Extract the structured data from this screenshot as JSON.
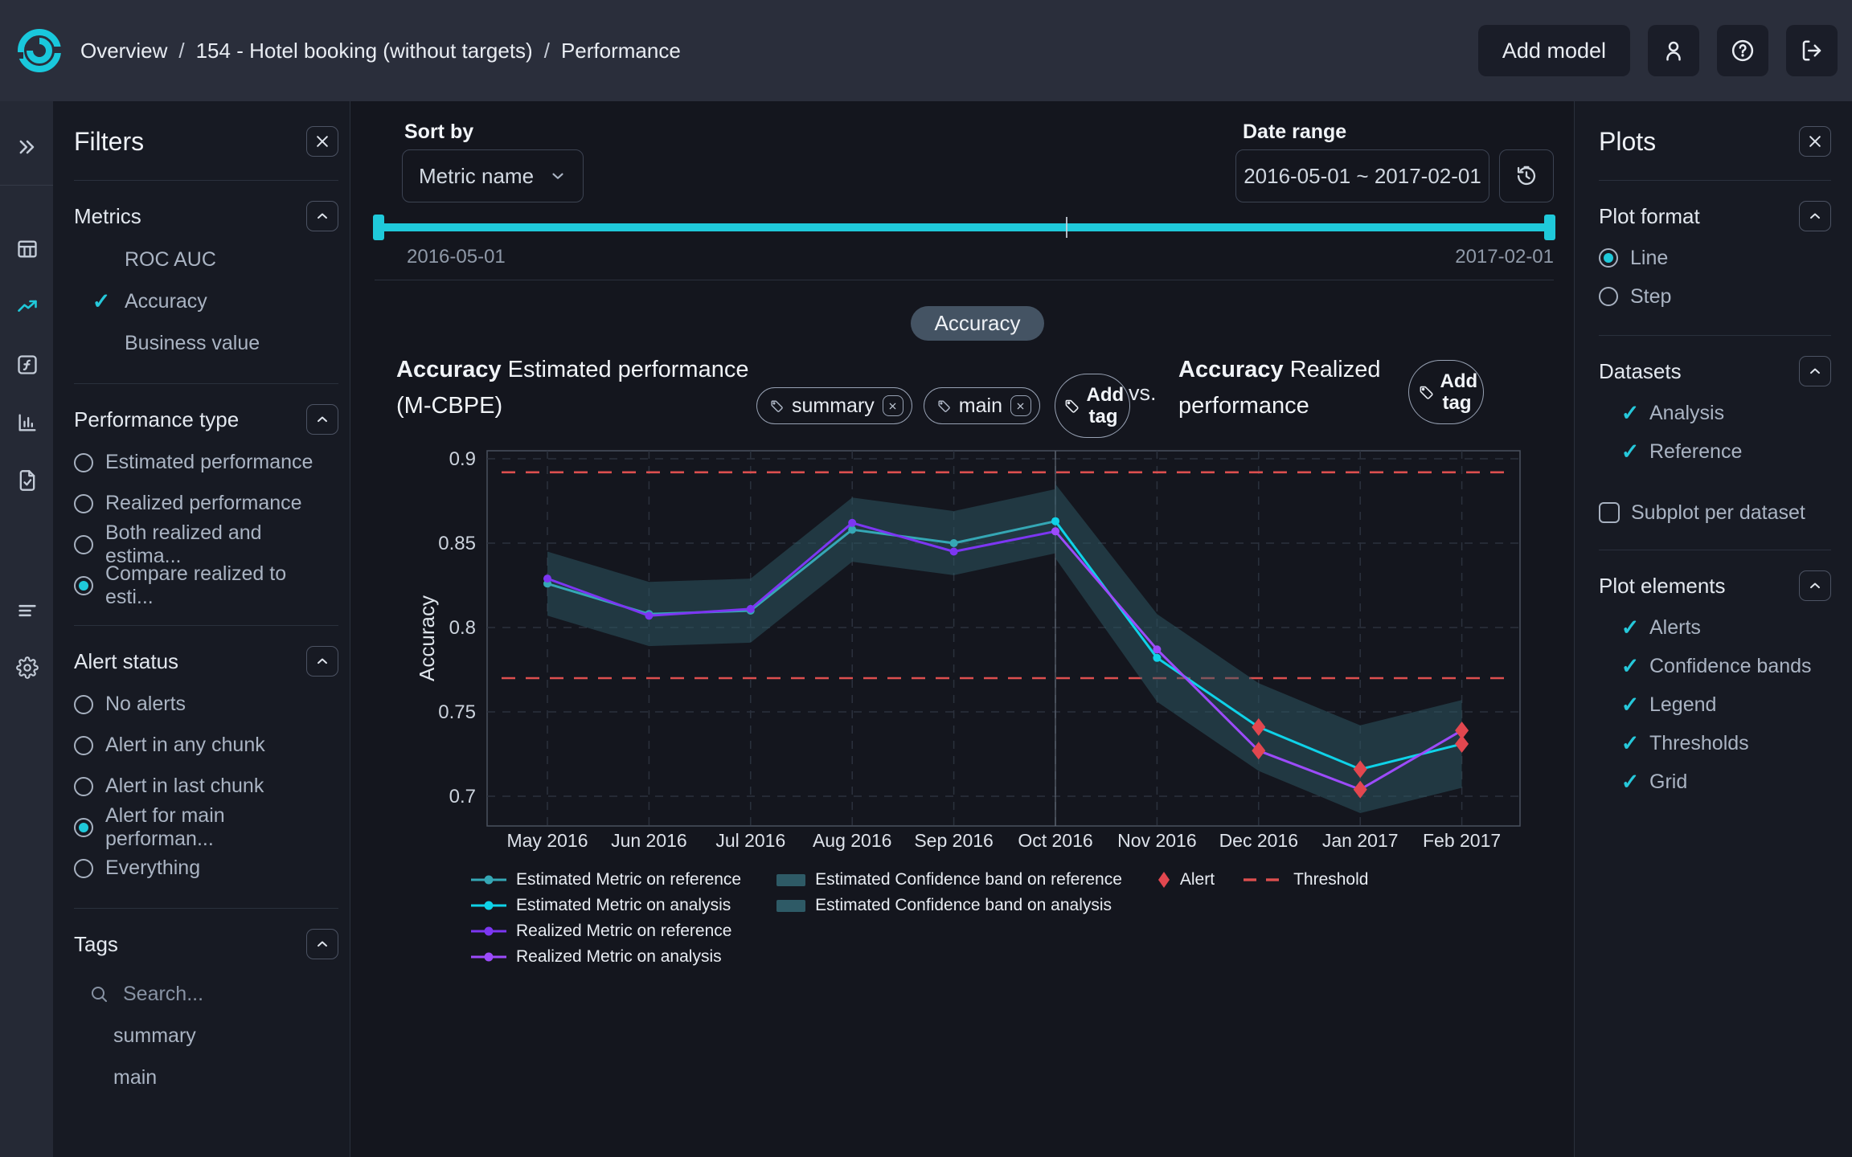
{
  "header": {
    "breadcrumb": [
      "Overview",
      "154 - Hotel booking (without targets)",
      "Performance"
    ],
    "separator": "/",
    "add_model_label": "Add model"
  },
  "toolbar": {
    "sort_by_label": "Sort by",
    "sort_by_value": "Metric name",
    "date_range_label": "Date range",
    "date_range_value": "2016-05-01 ~ 2017-02-01",
    "slider_start": "2016-05-01",
    "slider_end": "2017-02-01"
  },
  "filters": {
    "title": "Filters",
    "metrics": {
      "title": "Metrics",
      "items": [
        {
          "label": "ROC AUC",
          "checked": false
        },
        {
          "label": "Accuracy",
          "checked": true
        },
        {
          "label": "Business value",
          "checked": false
        }
      ]
    },
    "performance_type": {
      "title": "Performance type",
      "options": [
        {
          "label": "Estimated performance",
          "selected": false
        },
        {
          "label": "Realized performance",
          "selected": false
        },
        {
          "label": "Both realized and estima...",
          "selected": false
        },
        {
          "label": "Compare realized to esti...",
          "selected": true
        }
      ]
    },
    "alert_status": {
      "title": "Alert status",
      "options": [
        {
          "label": "No alerts",
          "selected": false
        },
        {
          "label": "Alert in any chunk",
          "selected": false
        },
        {
          "label": "Alert in last chunk",
          "selected": false
        },
        {
          "label": "Alert for main performan...",
          "selected": true
        },
        {
          "label": "Everything",
          "selected": false
        }
      ]
    },
    "tags": {
      "title": "Tags",
      "search_placeholder": "Search...",
      "items": [
        "summary",
        "main"
      ]
    }
  },
  "plot_header": {
    "metric_pill": "Accuracy",
    "left_title_bold": "Accuracy",
    "left_title_rest": " Estimated performance (M-CBPE)",
    "tags": [
      "summary",
      "main"
    ],
    "add_tag_label": "Add tag",
    "vs_label": "vs.",
    "right_title_bold": "Accuracy",
    "right_title_rest": " Realized performance"
  },
  "plots_panel": {
    "title": "Plots",
    "plot_format": {
      "title": "Plot format",
      "options": [
        {
          "label": "Line",
          "selected": true
        },
        {
          "label": "Step",
          "selected": false
        }
      ]
    },
    "datasets": {
      "title": "Datasets",
      "items": [
        {
          "label": "Analysis",
          "checked": true
        },
        {
          "label": "Reference",
          "checked": true
        }
      ],
      "subplot_label": "Subplot per dataset",
      "subplot_checked": false
    },
    "plot_elements": {
      "title": "Plot elements",
      "items": [
        {
          "label": "Alerts",
          "checked": true
        },
        {
          "label": "Confidence bands",
          "checked": true
        },
        {
          "label": "Legend",
          "checked": true
        },
        {
          "label": "Thresholds",
          "checked": true
        },
        {
          "label": "Grid",
          "checked": true
        }
      ]
    }
  },
  "chart_data": {
    "type": "line",
    "ylabel": "Accuracy",
    "categories": [
      "May 2016",
      "Jun 2016",
      "Jul 2016",
      "Aug 2016",
      "Sep 2016",
      "Oct 2016",
      "Nov 2016",
      "Dec 2016",
      "Jan 2017",
      "Feb 2017"
    ],
    "yticks": [
      0.7,
      0.75,
      0.8,
      0.85,
      0.9
    ],
    "ylim": [
      0.682,
      0.905
    ],
    "grid": true,
    "legend_position": "bottom-left",
    "split_index": 5,
    "series": [
      {
        "name": "Estimated Metric on reference",
        "color": "#35a7b5",
        "values": [
          0.826,
          0.808,
          0.81,
          0.858,
          0.85,
          0.863,
          null,
          null,
          null,
          null
        ]
      },
      {
        "name": "Estimated Metric on analysis",
        "color": "#0fd2e8",
        "values": [
          null,
          null,
          null,
          null,
          null,
          0.863,
          0.782,
          0.741,
          0.716,
          0.731
        ]
      },
      {
        "name": "Realized Metric on reference",
        "color": "#7c36f2",
        "values": [
          0.829,
          0.807,
          0.811,
          0.862,
          0.845,
          0.857,
          null,
          null,
          null,
          null
        ]
      },
      {
        "name": "Realized Metric on analysis",
        "color": "#9c4bfb",
        "values": [
          null,
          null,
          null,
          null,
          null,
          0.857,
          0.787,
          0.727,
          0.704,
          0.739
        ]
      }
    ],
    "bands": [
      {
        "name": "Estimated Confidence band on reference",
        "color": "#2e5a66",
        "upper": [
          0.845,
          0.827,
          0.829,
          0.877,
          0.869,
          0.882,
          null,
          null,
          null,
          null
        ],
        "lower": [
          0.807,
          0.789,
          0.791,
          0.839,
          0.831,
          0.844,
          null,
          null,
          null,
          null
        ]
      },
      {
        "name": "Estimated Confidence band on analysis",
        "color": "#2e5a66",
        "upper": [
          null,
          null,
          null,
          null,
          null,
          0.885,
          0.808,
          0.767,
          0.742,
          0.757
        ],
        "lower": [
          null,
          null,
          null,
          null,
          null,
          0.841,
          0.756,
          0.715,
          0.69,
          0.705
        ]
      }
    ],
    "alerts": {
      "label": "Alert",
      "color": "#e2474f",
      "points": [
        {
          "series_index": 1,
          "point_index": 7,
          "value": 0.741
        },
        {
          "series_index": 1,
          "point_index": 8,
          "value": 0.716
        },
        {
          "series_index": 1,
          "point_index": 9,
          "value": 0.731
        },
        {
          "series_index": 3,
          "point_index": 7,
          "value": 0.727
        },
        {
          "series_index": 3,
          "point_index": 8,
          "value": 0.704
        },
        {
          "series_index": 3,
          "point_index": 9,
          "value": 0.739
        }
      ]
    },
    "thresholds": {
      "label": "Threshold",
      "color": "#dd4f4f",
      "values": [
        0.892,
        0.77
      ]
    }
  }
}
